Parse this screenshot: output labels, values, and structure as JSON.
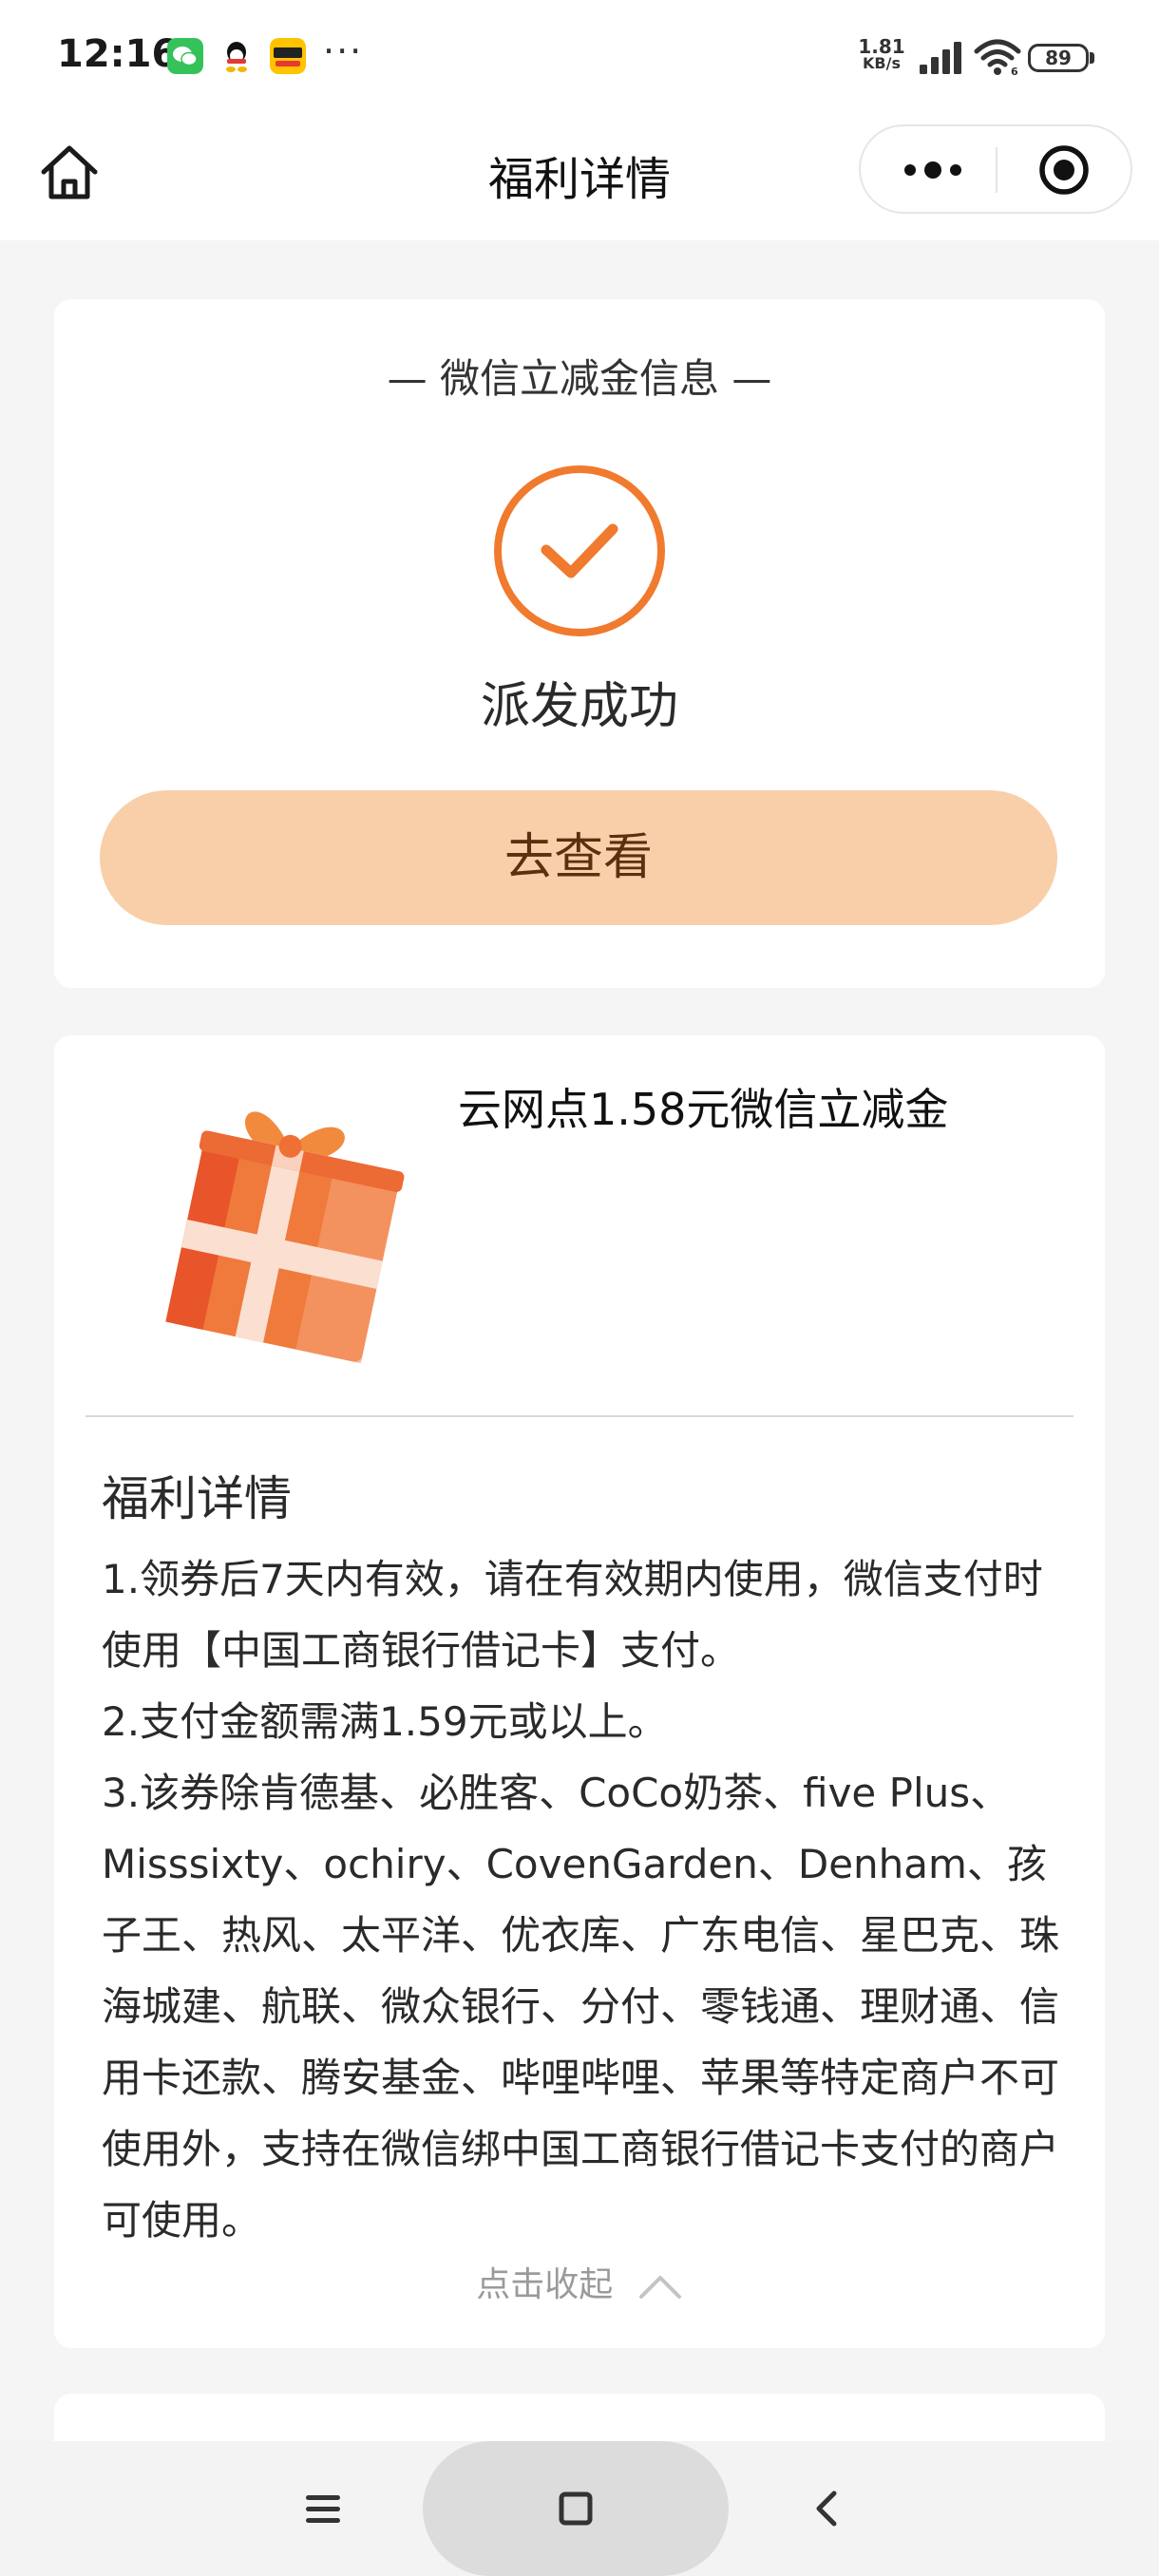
{
  "status_bar": {
    "time": "12:16",
    "more_indicator": "···",
    "net_speed_value": "1.81",
    "net_speed_unit": "KB/s",
    "battery_level": "89",
    "icons": [
      "wechat-icon",
      "qq-icon",
      "meituan-icon",
      "signal-icon",
      "wifi-icon",
      "battery-icon"
    ]
  },
  "nav": {
    "title": "福利详情",
    "home_icon": "home-icon",
    "more_icon": "more-dots-icon",
    "close_icon": "target-close-icon"
  },
  "status_card": {
    "heading": "— 微信立减金信息 —",
    "result_text": "派发成功",
    "view_button": "去查看",
    "accent_color": "#F07A2E",
    "button_color": "#F8CFA9"
  },
  "detail_card": {
    "coupon_title": "云网点1.58元微信立减金",
    "details_heading": "福利详情",
    "terms": [
      "1.领券后7天内有效，请在有效期内使用，微信支付时使用【中国工商银行借记卡】支付。",
      "2.支付金额需满1.59元或以上。",
      "3.该券除肯德基、必胜客、CoCo奶茶、five Plus、Misssixty、ochiry、CovenGarden、Denham、孩子王、热风、太平洋、优衣库、广东电信、星巴克、珠海城建、航联、微众银行、分付、零钱通、理财通、信用卡还款、腾安基金、哔哩哔哩、苹果等特定商户不可使用外，支持在微信绑中国工商银行借记卡支付的商户可使用。"
    ],
    "collapse_label": "点击收起"
  },
  "system_nav": {
    "menu_icon": "menu-icon",
    "home_icon": "square-home-icon",
    "back_icon": "back-icon"
  }
}
